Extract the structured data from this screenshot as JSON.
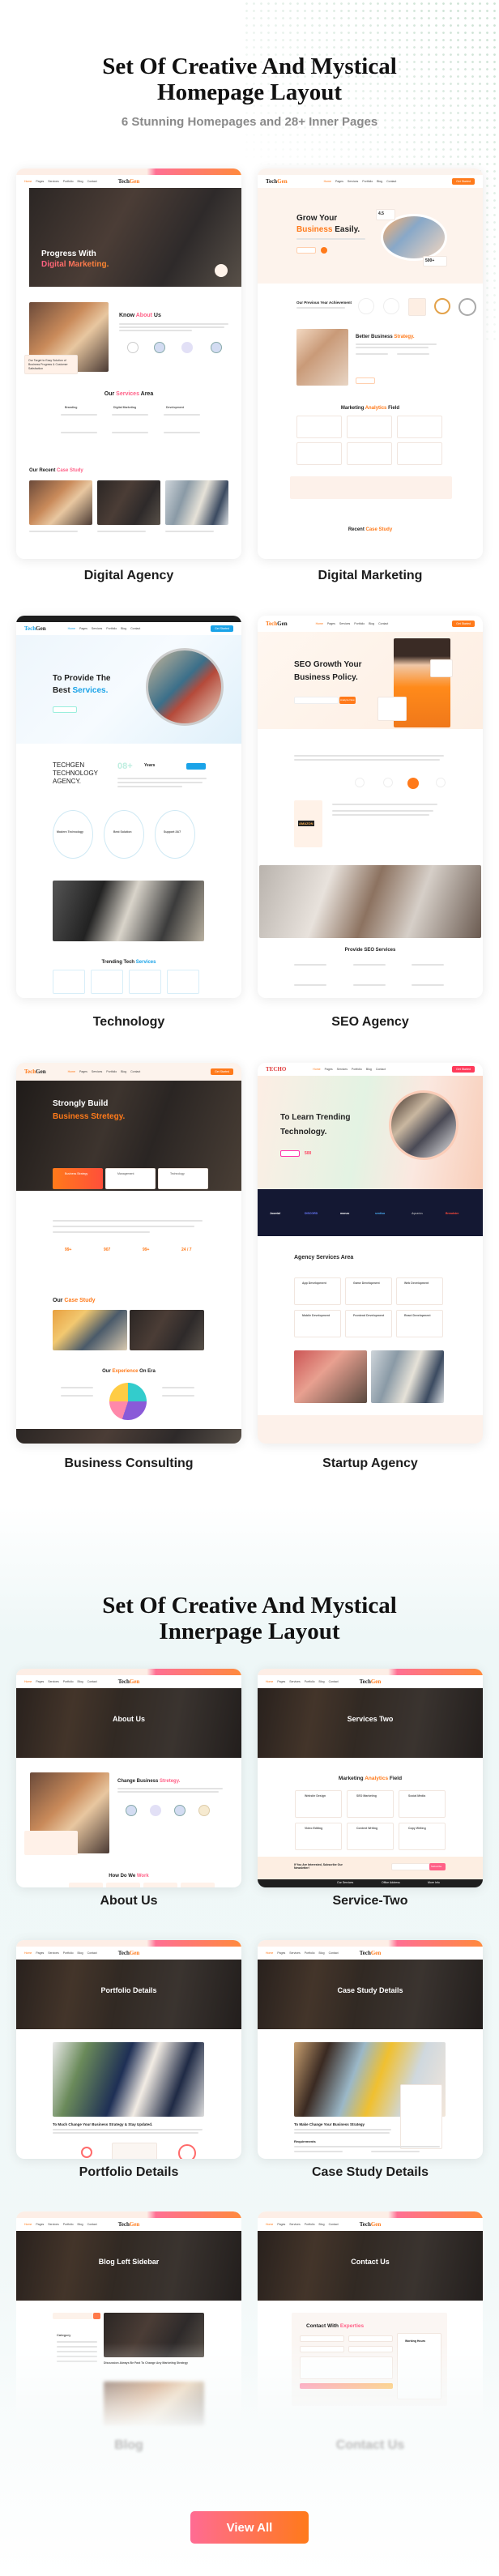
{
  "colors": {
    "accent": "#ff7a1a",
    "pink": "#ff5f86",
    "tech_blue": "#1aa3e8",
    "startup_navy": "#141833"
  },
  "homepage_section": {
    "title_line1": "Set Of Creative And Mystical",
    "title_line2": "Homepage Layout",
    "subtitle": "6 Stunning Homepages and 28+ Inner Pages"
  },
  "innerpage_section": {
    "title_line1": "Set Of Creative And Mystical",
    "title_line2": "Innerpage Layout"
  },
  "nav": {
    "items": [
      "Home",
      "Pages",
      "Services",
      "Portfolio",
      "Blog",
      "Contact"
    ],
    "logo_a": "Tech",
    "logo_b": "Gen",
    "cta": "Get Started"
  },
  "home": [
    {
      "label": "Digital Agency",
      "hero_l1": "Progress With",
      "hero_l2": "Digital Marketing.",
      "about_a": "Know",
      "about_b": "About",
      "about_c": "Us",
      "about_note": "Our Target to Easy Solution of Business Progress & Customer Satisfaction",
      "services_a": "Our",
      "services_b": "Services",
      "services_c": "Area",
      "services": [
        "Branding",
        "Digital Marketing",
        "Development"
      ],
      "case_a": "Our Recent",
      "case_b": "Case Study"
    },
    {
      "label": "Digital Marketing",
      "hero_l1": "Grow Your",
      "hero_l2a": "Business",
      "hero_l2b": "Easily.",
      "rating": "4.5",
      "projects": "500+",
      "achieve": "Our Previous Year Achievement",
      "strategy_a": "Better Business",
      "strategy_b": "Strategy.",
      "analytics_a": "Marketing",
      "analytics_b": "Analytics",
      "analytics_c": "Field",
      "case_a": "Recent",
      "case_b": "Case Study"
    },
    {
      "label": "Technology",
      "hero_l1": "To Provide The",
      "hero_l2a": "Best",
      "hero_l2b": "Services.",
      "agency": "TECHGEN TECHNOLOGY AGENCY.",
      "years": "08+",
      "years_label": "Years",
      "features": [
        "Modern Technology",
        "Best Solution",
        "Support 24/7"
      ],
      "trending_a": "Trending Tech",
      "trending_b": "Services"
    },
    {
      "label": "SEO Agency",
      "hero_l1": "SEO Growth Your",
      "hero_l2": "Business Policy.",
      "analyze": "Analyze Now",
      "badge": "AMAZON",
      "services": "Provide SEO Services"
    },
    {
      "label": "Business Consulting",
      "hero_l1": "Strongly Build",
      "hero_l2": "Business Stretegy.",
      "boxes": [
        "Business Strategy",
        "Management",
        "Technology"
      ],
      "stats": [
        "99+",
        "907",
        "99+",
        "24 / 7"
      ],
      "case_a": "Our",
      "case_b": "Case Study",
      "experience_a": "Our",
      "experience_b": "Experience",
      "experience_c": "On Era"
    },
    {
      "label": "Startup Agency",
      "logo": "TECHO",
      "hero_l1": "To Learn Trending",
      "hero_l2": "Technology.",
      "count": "500",
      "brands": [
        "Joomla!",
        "DISCORD",
        "monzo",
        "sentisa",
        "Aquarius",
        "Breadster"
      ],
      "services": "Agency Services Area",
      "service_items": [
        "App Development",
        "Game Development",
        "Web Development",
        "Mobile Development",
        "Frontend Development",
        "React Development"
      ]
    }
  ],
  "inner": [
    {
      "label": "About Us",
      "title": "About Us",
      "h_a": "Change Business",
      "h_b": "Stretegy.",
      "work_a": "How Do We",
      "work_b": "Work",
      "steps": [
        "Problem",
        "Structure",
        "Execution",
        "Extended"
      ]
    },
    {
      "label": "Service-Two",
      "title": "Services Two",
      "h_a": "Marketing",
      "h_b": "Analytics",
      "h_c": "Field",
      "items": [
        "Website Design",
        "SEO Marketing",
        "Social Media",
        "Video Editing",
        "Content Writing",
        "Copy Writing"
      ],
      "newsletter": "If You Are Interested, Subscribe Our Newsletter!",
      "subscribe": "Subscribe",
      "footer": [
        "Our Services",
        "Office Address",
        "More Info"
      ]
    },
    {
      "label": "Portfolio Details",
      "title": "Portfolio Details",
      "heading": "To Much Change Your Business Strategy & Stay Updated."
    },
    {
      "label": "Case Study Details",
      "title": "Case Study Details",
      "heading": "To Make Change Your Business Strategy",
      "req": "Requirements"
    },
    {
      "label": "Blog",
      "title": "Blog Left Sidebar",
      "category": "Category",
      "post": "Discussion Always Be Fast To Change Any Marketing Strategy"
    },
    {
      "label": "Contact Us",
      "title": "Contact Us",
      "h_a": "Contact With",
      "h_b": "Experties",
      "hours": "Working Hours"
    }
  ],
  "view_all": "View All"
}
